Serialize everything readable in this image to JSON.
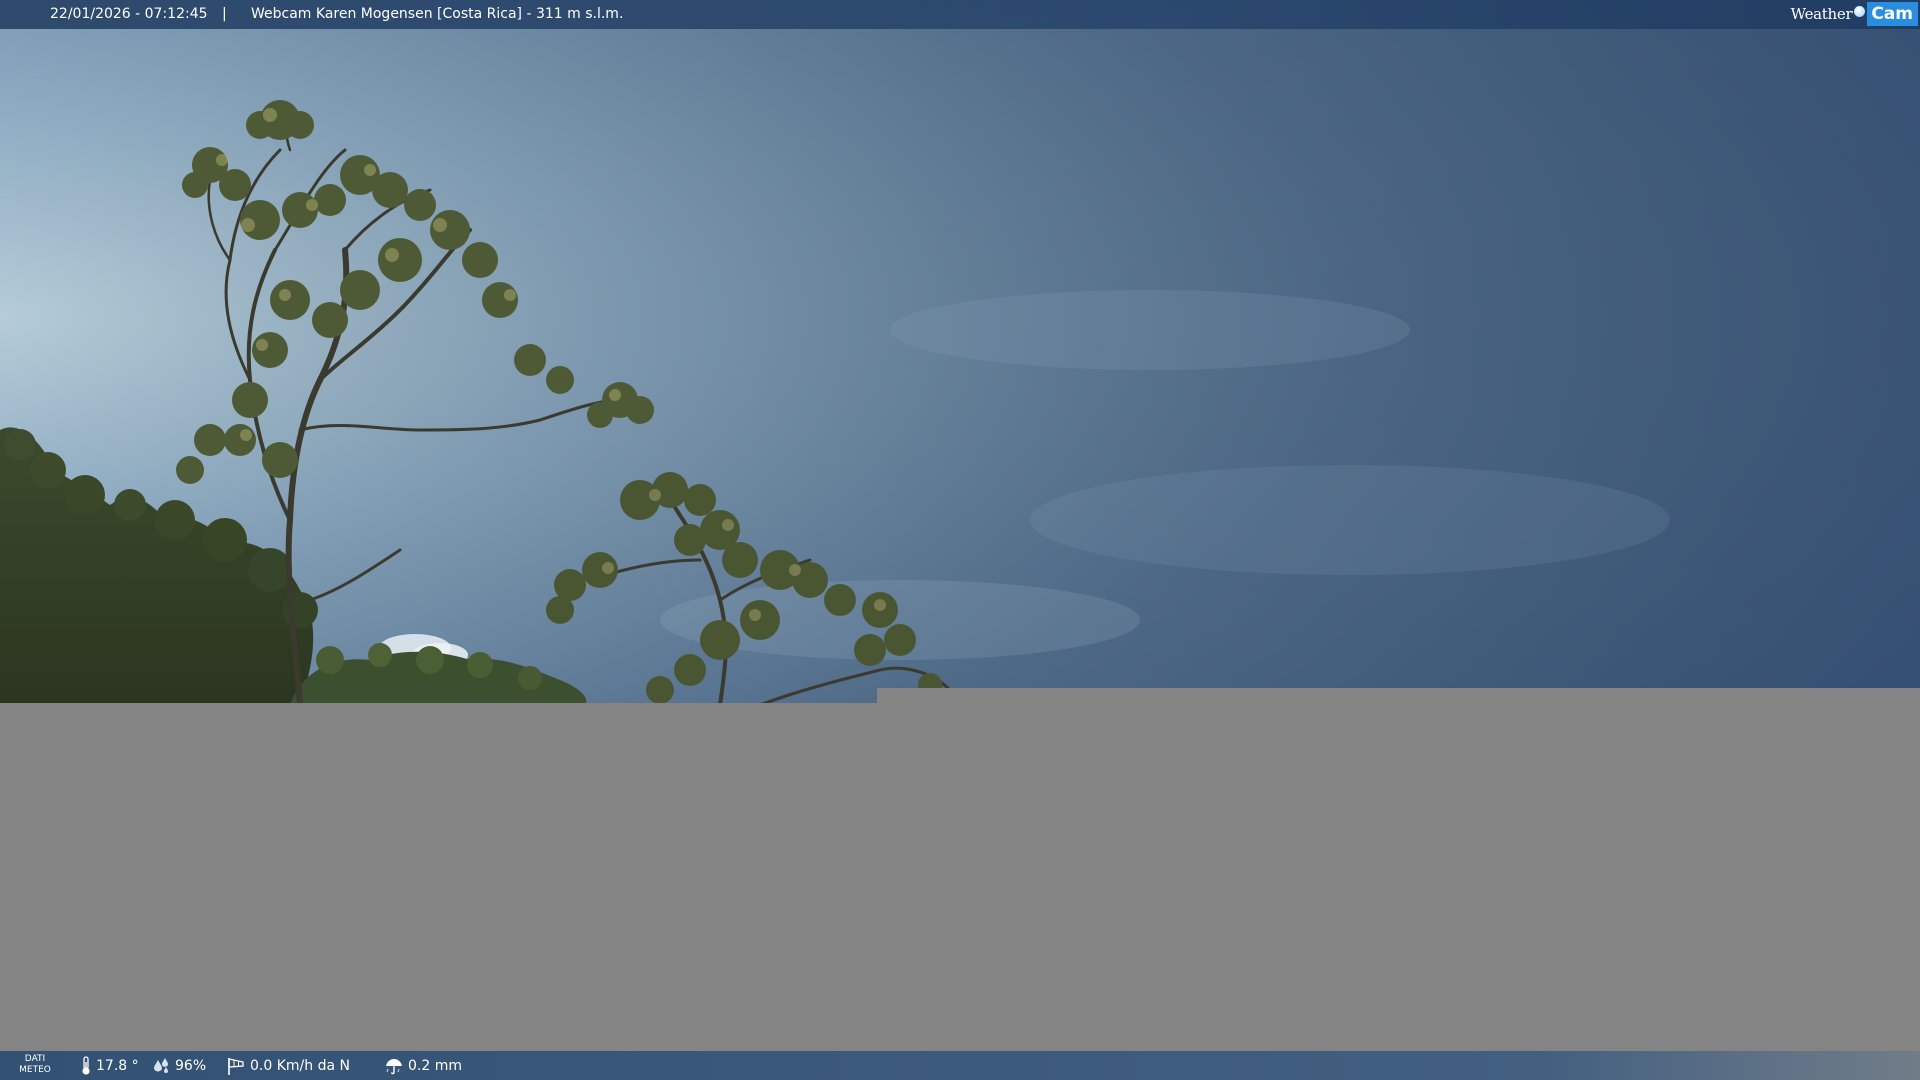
{
  "header": {
    "datetime": "22/01/2026 - 07:12:45",
    "separator": "|",
    "title": "Webcam Karen Mogensen [Costa Rica]  - 311 m s.l.m."
  },
  "logo": {
    "weather": "Weather",
    "cam": "Cam"
  },
  "weather_data": {
    "label_line1": "DATI",
    "label_line2": "METEO",
    "temperature": "17.8 °",
    "humidity": "96%",
    "wind": "0.0 Km/h da N",
    "rain": "0.2 mm"
  },
  "colors": {
    "sky_top": "#3f5f82",
    "sky_left": "#a7c0d0",
    "blank_area": "#848484",
    "bar_blue": "#2a4a72",
    "logo_blue": "#2a8ee0"
  }
}
